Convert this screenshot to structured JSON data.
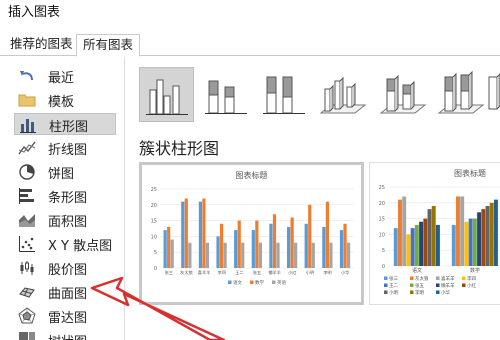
{
  "window": {
    "title": "插入图表"
  },
  "tabs": [
    {
      "label": "推荐的图表"
    },
    {
      "label": "所有图表"
    }
  ],
  "chart_types": [
    {
      "label": "最近",
      "icon": "undo-icon"
    },
    {
      "label": "模板",
      "icon": "folder-icon"
    },
    {
      "label": "柱形图",
      "icon": "column-chart-icon",
      "selected": true
    },
    {
      "label": "折线图",
      "icon": "line-chart-icon"
    },
    {
      "label": "饼图",
      "icon": "pie-chart-icon"
    },
    {
      "label": "条形图",
      "icon": "bar-chart-icon"
    },
    {
      "label": "面积图",
      "icon": "area-chart-icon"
    },
    {
      "label": "X Y 散点图",
      "icon": "scatter-chart-icon"
    },
    {
      "label": "股价图",
      "icon": "stock-chart-icon"
    },
    {
      "label": "曲面图",
      "icon": "surface-chart-icon"
    },
    {
      "label": "雷达图",
      "icon": "radar-chart-icon"
    },
    {
      "label": "树状图",
      "icon": "treemap-chart-icon"
    }
  ],
  "subtype_section_title": "簇状柱形图",
  "colors": {
    "blue": "#5b9bd5",
    "orange": "#ed7d31",
    "gray": "#a5a5a5",
    "yellow": "#ffc000",
    "arrow": "#d63031"
  },
  "chart_data": [
    {
      "type": "bar",
      "title": "图表标题",
      "categories": [
        "张三",
        "灰太狼",
        "喜羊羊",
        "李四",
        "王二",
        "张五",
        "懒羊羊",
        "小红",
        "小明",
        "李明",
        "小华"
      ],
      "series": [
        {
          "name": "语文",
          "values": [
            12,
            21,
            21,
            10,
            12,
            12,
            14,
            13,
            14,
            13,
            12
          ]
        },
        {
          "name": "数学",
          "values": [
            13,
            22,
            22,
            14,
            15,
            15,
            17,
            16,
            20,
            21,
            14
          ]
        },
        {
          "name": "英语",
          "values": [
            9,
            8,
            8,
            8,
            8,
            8,
            8,
            8,
            8,
            8,
            8
          ]
        }
      ],
      "ylim": [
        0,
        25
      ],
      "yticks": [
        0,
        5,
        10,
        15,
        20,
        25
      ],
      "legend": "bottom"
    },
    {
      "type": "bar",
      "title": "图表标题",
      "categories": [
        "语文",
        "数学"
      ],
      "series": [
        {
          "name": "张三",
          "values": [
            12,
            13
          ]
        },
        {
          "name": "灰太狼",
          "values": [
            21,
            22
          ]
        },
        {
          "name": "喜羊羊",
          "values": [
            22,
            22
          ]
        },
        {
          "name": "李四",
          "values": [
            10,
            14
          ]
        },
        {
          "name": "王二",
          "values": [
            12,
            15
          ]
        },
        {
          "name": "张五",
          "values": [
            13,
            15
          ]
        },
        {
          "name": "懒羊羊",
          "values": [
            14,
            17
          ]
        },
        {
          "name": "小红",
          "values": [
            15,
            18
          ]
        },
        {
          "name": "小明",
          "values": [
            18,
            19
          ]
        },
        {
          "name": "李明",
          "values": [
            19,
            20
          ]
        },
        {
          "name": "小华",
          "values": [
            13,
            21
          ]
        }
      ],
      "ylim": [
        0,
        25
      ],
      "yticks": [
        0,
        5,
        10,
        15,
        20,
        25
      ],
      "legend": "bottom"
    }
  ]
}
